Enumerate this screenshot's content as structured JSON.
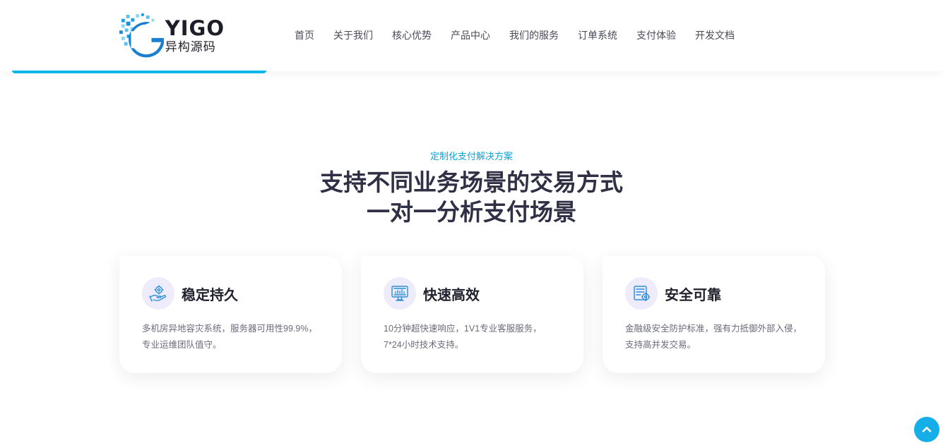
{
  "brand": {
    "logo_en": "YIGO",
    "logo_cn": "异构源码",
    "accent": "#0bb7e6"
  },
  "nav": {
    "items": [
      "首页",
      "关于我们",
      "核心优势",
      "产品中心",
      "我们的服务",
      "订单系统",
      "支付体验",
      "开发文档"
    ]
  },
  "section": {
    "subtitle": "定制化支付解决方案",
    "title_line1": "支持不同业务场景的交易方式",
    "title_line2": "一对一分析支付场景"
  },
  "cards": [
    {
      "icon": "hand-gear-icon",
      "title": "稳定持久",
      "desc_line1": "多机房异地容灾系统，服务器可用性99.9%，",
      "desc_line2": "专业运维团队值守。"
    },
    {
      "icon": "monitor-chart-icon",
      "title": "快速高效",
      "desc_line1": "10分钟超快速响应，1V1专业客服服务，",
      "desc_line2": "7*24小时技术支持。"
    },
    {
      "icon": "server-shield-icon",
      "title": "安全可靠",
      "desc_line1": "金融级安全防护标准，强有力抵御外部入侵，",
      "desc_line2": "支持高并发交易。"
    }
  ],
  "back_to_top": {
    "icon": "chevron-up-icon",
    "color": "#15aee8"
  }
}
